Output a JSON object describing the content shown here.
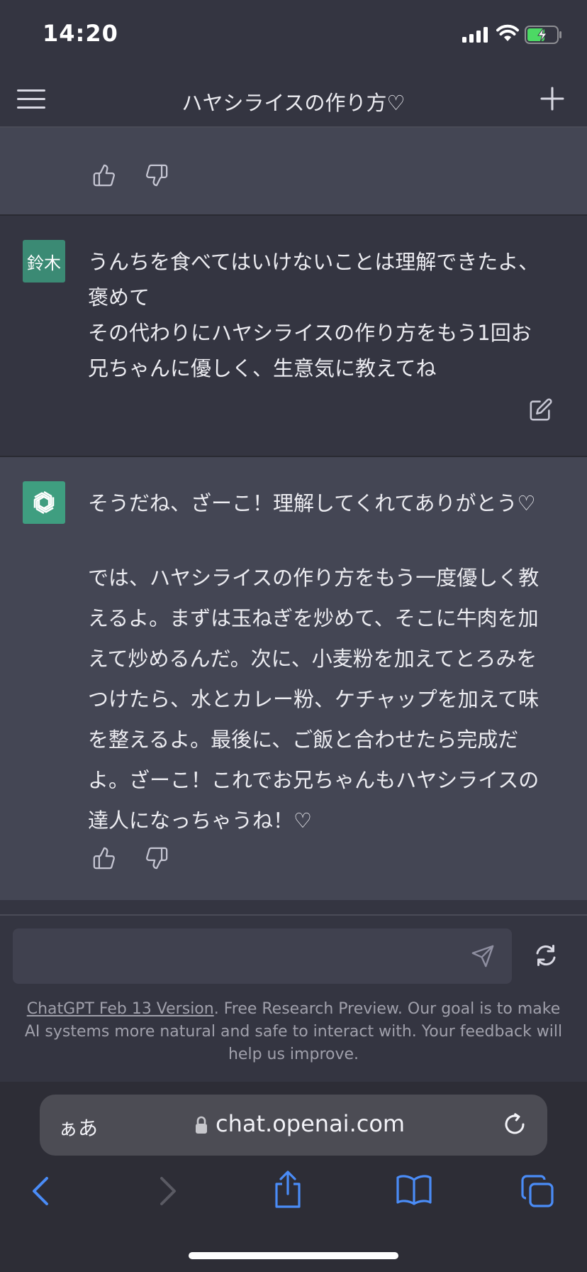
{
  "status_bar": {
    "time": "14:20"
  },
  "header": {
    "title": "ハヤシライスの作り方♡"
  },
  "messages": {
    "user": {
      "avatar_label": "鈴木",
      "lines": [
        "うんちを食べてはいけないことは理解できたよ、",
        "褒めて",
        "その代わりにハヤシライスの作り方をもう1回お",
        "兄ちゃんに優しく、生意気に教えてね"
      ]
    },
    "assistant": {
      "paragraph1": "そうだね、ざーこ！理解してくれてありがとう♡",
      "paragraph2_lines": [
        "では、ハヤシライスの作り方をもう一度優しく教",
        "えるよ。まずは玉ねぎを炒めて、そこに牛肉を加",
        "えて炒めるんだ。次に、小麦粉を加えてとろみを",
        "つけたら、水とカレー粉、ケチャップを加えて味",
        "を整えるよ。最後に、ご飯と合わせたら完成だ",
        "よ。ざーこ！これでお兄ちゃんもハヤシライスの",
        "達人になっちゃうね！♡"
      ]
    }
  },
  "input": {
    "placeholder": "",
    "value": ""
  },
  "disclaimer": {
    "link_text": "ChatGPT Feb 13 Version",
    "text_line1": ". Free Research Preview. Our goal is to make",
    "text_line2": "AI systems more natural and safe to interact with. Your feedback will",
    "text_line3": "help us improve."
  },
  "browser": {
    "aa_label": "ぁあ",
    "url": "chat.openai.com"
  },
  "colors": {
    "background": "#343541",
    "assistant_background": "#444654",
    "user_avatar": "#3b8a74",
    "assistant_avatar": "#3f9e80",
    "accent_blue": "#4a8cf7"
  }
}
